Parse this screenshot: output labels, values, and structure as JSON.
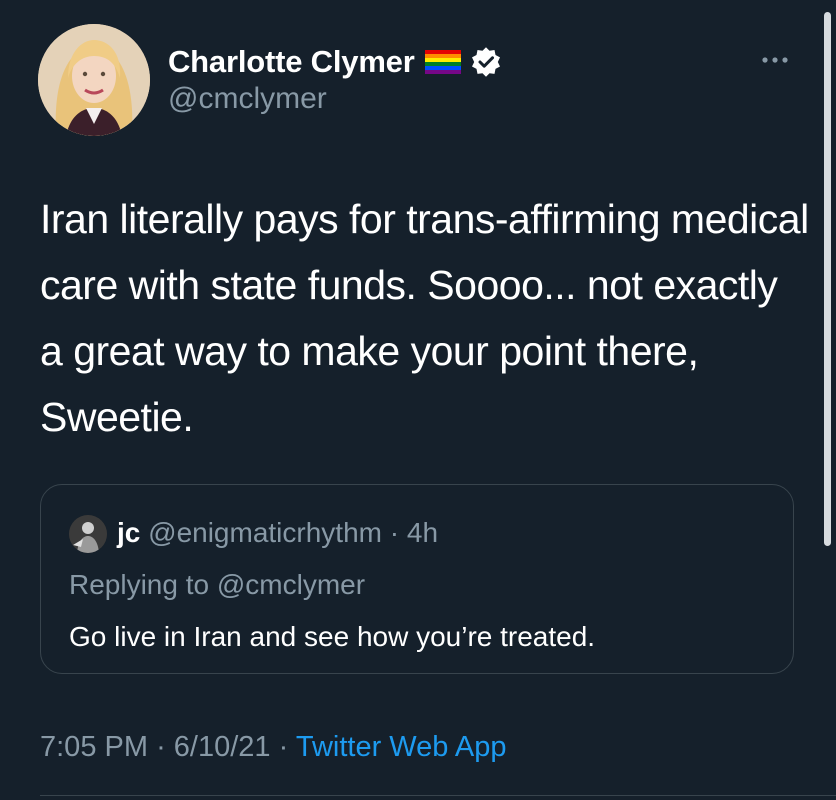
{
  "author": {
    "display_name": "Charlotte Clymer",
    "handle": "@cmclymer"
  },
  "tweet": {
    "text": "Iran literally pays for trans-affirming medical care with state funds. Soooo... not exactly a great way to make your point there, Sweetie."
  },
  "quoted_tweet": {
    "name": "jc",
    "handle": "@enigmaticrhythm",
    "separator": "·",
    "age": "4h",
    "replying_to": "Replying to @cmclymer",
    "text": "Go live in Iran and see how you’re treated."
  },
  "footer": {
    "time": "7:05 PM",
    "dot1": "·",
    "date": "6/10/21",
    "dot2": "·",
    "source": "Twitter Web App"
  },
  "colors": {
    "background": "#15202b",
    "secondary_text": "#8899a6",
    "link": "#1d9bf0",
    "border": "#38444d",
    "verified_badge": "#ffffff"
  },
  "icons": {
    "flag": "rainbow-flag-icon",
    "verified": "verified-badge-icon",
    "more": "more-options-icon"
  }
}
